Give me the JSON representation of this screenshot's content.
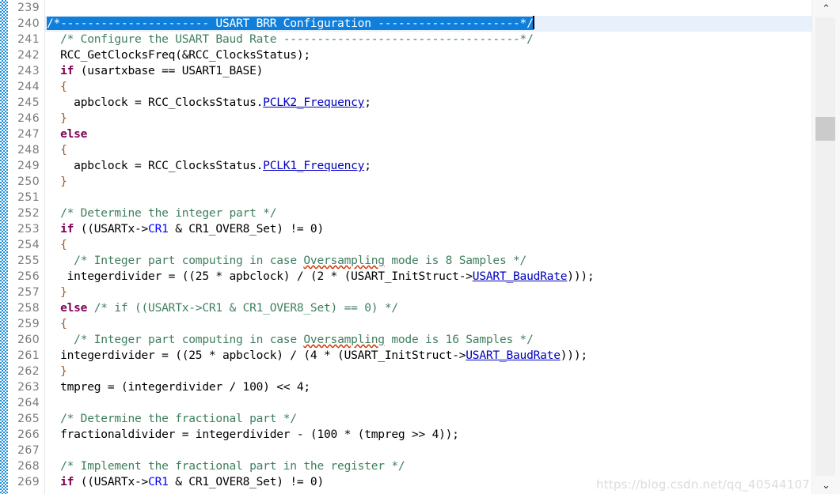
{
  "editor": {
    "first_line_number": 239,
    "current_line_number": 240,
    "selection_text": "/*---------------------- USART BRR Configuration ---------------------*/",
    "watermark": "https://blog.csdn.net/qq_40544107",
    "scroll_up_icon": "chevron-up-icon",
    "scroll_down_icon": "chevron-down-icon",
    "scroll_up_glyph": "⌃",
    "scroll_down_glyph": "⌄"
  },
  "line_numbers": [
    "239",
    "240",
    "241",
    "242",
    "243",
    "244",
    "245",
    "246",
    "247",
    "248",
    "249",
    "250",
    "251",
    "252",
    "253",
    "254",
    "255",
    "256",
    "257",
    "258",
    "259",
    "260",
    "261",
    "262",
    "263",
    "264",
    "265",
    "266",
    "267",
    "268",
    "269"
  ],
  "lines": [
    {
      "n": "239",
      "text": ""
    },
    {
      "n": "240",
      "text": "/*---------------------- USART BRR Configuration ---------------------*/"
    },
    {
      "n": "241",
      "text": "  /* Configure the USART Baud Rate -----------------------------------*/"
    },
    {
      "n": "242",
      "text": "  RCC_GetClocksFreq(&RCC_ClocksStatus);"
    },
    {
      "n": "243",
      "text": "  if (usartxbase == USART1_BASE)"
    },
    {
      "n": "244",
      "text": "  {"
    },
    {
      "n": "245",
      "text": "    apbclock = RCC_ClocksStatus.PCLK2_Frequency;"
    },
    {
      "n": "246",
      "text": "  }"
    },
    {
      "n": "247",
      "text": "  else"
    },
    {
      "n": "248",
      "text": "  {"
    },
    {
      "n": "249",
      "text": "    apbclock = RCC_ClocksStatus.PCLK1_Frequency;"
    },
    {
      "n": "250",
      "text": "  }"
    },
    {
      "n": "251",
      "text": ""
    },
    {
      "n": "252",
      "text": "  /* Determine the integer part */"
    },
    {
      "n": "253",
      "text": "  if ((USARTx->CR1 & CR1_OVER8_Set) != 0)"
    },
    {
      "n": "254",
      "text": "  {"
    },
    {
      "n": "255",
      "text": "    /* Integer part computing in case Oversampling mode is 8 Samples */"
    },
    {
      "n": "256",
      "text": "    integerdivider = ((25 * apbclock) / (2 * (USART_InitStruct->USART_BaudRate)));"
    },
    {
      "n": "257",
      "text": "  }"
    },
    {
      "n": "258",
      "text": "  else /* if ((USARTx->CR1 & CR1_OVER8_Set) == 0) */"
    },
    {
      "n": "259",
      "text": "  {"
    },
    {
      "n": "260",
      "text": "    /* Integer part computing in case Oversampling mode is 16 Samples */"
    },
    {
      "n": "261",
      "text": "  integerdivider = ((25 * apbclock) / (4 * (USART_InitStruct->USART_BaudRate)));"
    },
    {
      "n": "262",
      "text": "  }"
    },
    {
      "n": "263",
      "text": "  tmpreg = (integerdivider / 100) << 4;"
    },
    {
      "n": "264",
      "text": ""
    },
    {
      "n": "265",
      "text": "  /* Determine the fractional part */"
    },
    {
      "n": "266",
      "text": "  fractionaldivider = integerdivider - (100 * (tmpreg >> 4));"
    },
    {
      "n": "267",
      "text": ""
    },
    {
      "n": "268",
      "text": "  /* Implement the fractional part in the register */"
    },
    {
      "n": "269",
      "text": "  if ((USARTx->CR1 & CR1_OVER8_Set) != 0)"
    }
  ],
  "tokens": {
    "ln240_sel": "/*---------------------- USART BRR Configuration ---------------------*/",
    "ln241_comment": "/* Configure the USART Baud Rate -----------------------------------*/",
    "ln242_call": "RCC_GetClocksFreq(&RCC_ClocksStatus);",
    "ln243_kw": "if",
    "ln243_rest": " (usartxbase == USART1_BASE)",
    "ln244_brace": "{",
    "ln245_a": "apbclock = RCC_ClocksStatus.",
    "ln245_mem": "PCLK2_Frequency",
    "ln245_b": ";",
    "ln246_brace": "}",
    "ln247_kw": "else",
    "ln248_brace": "{",
    "ln249_a": "apbclock = RCC_ClocksStatus.",
    "ln249_mem": "PCLK1_Frequency",
    "ln249_b": ";",
    "ln250_brace": "}",
    "ln252_comment": "/* Determine the integer part */",
    "ln253_kw": "if",
    "ln253_a": " ((USARTx->",
    "ln253_mem": "CR1",
    "ln253_b": " & CR1_OVER8_Set) != 0)",
    "ln254_brace": "{",
    "ln255_c1": "/* Integer part computing in case ",
    "ln255_sp": "Oversampling",
    "ln255_c2": " mode is 8 Samples */",
    "ln256_a": "integerdivider = ((25 * apbclock) / (2 * (USART_InitStruct->",
    "ln256_mem": "USART_BaudRate",
    "ln256_b": ")));",
    "ln257_brace": "}",
    "ln258_kw": "else",
    "ln258_comment": " /* if ((USARTx->CR1 & CR1_OVER8_Set) == 0) */",
    "ln259_brace": "{",
    "ln260_c1": "/* Integer part computing in case ",
    "ln260_sp": "Oversampling",
    "ln260_c2": " mode is 16 Samples */",
    "ln261_a": "integerdivider = ((25 * apbclock) / (4 * (USART_InitStruct->",
    "ln261_mem": "USART_BaudRate",
    "ln261_b": ")));",
    "ln262_brace": "}",
    "ln263_stmt": "tmpreg = (integerdivider / 100) << 4;",
    "ln265_comment": "/* Determine the fractional part */",
    "ln266_stmt": "fractionaldivider = integerdivider - (100 * (tmpreg >> 4));",
    "ln268_comment": "/* Implement the fractional part in the register */",
    "ln269_kw": "if",
    "ln269_a": " ((USARTx->",
    "ln269_mem": "CR1",
    "ln269_b": " & CR1_OVER8_Set) != 0)"
  },
  "colors": {
    "comment": "#3f7f5f",
    "keyword": "#7f0055",
    "member": "#0000c0",
    "brace": "#a05a2c",
    "selection": "#0f7fdb",
    "current_line": "#e8f0fb",
    "linenum": "#7a7a7a",
    "change_bar": "#1f8fd8",
    "spellcheck": "#cc3300"
  }
}
